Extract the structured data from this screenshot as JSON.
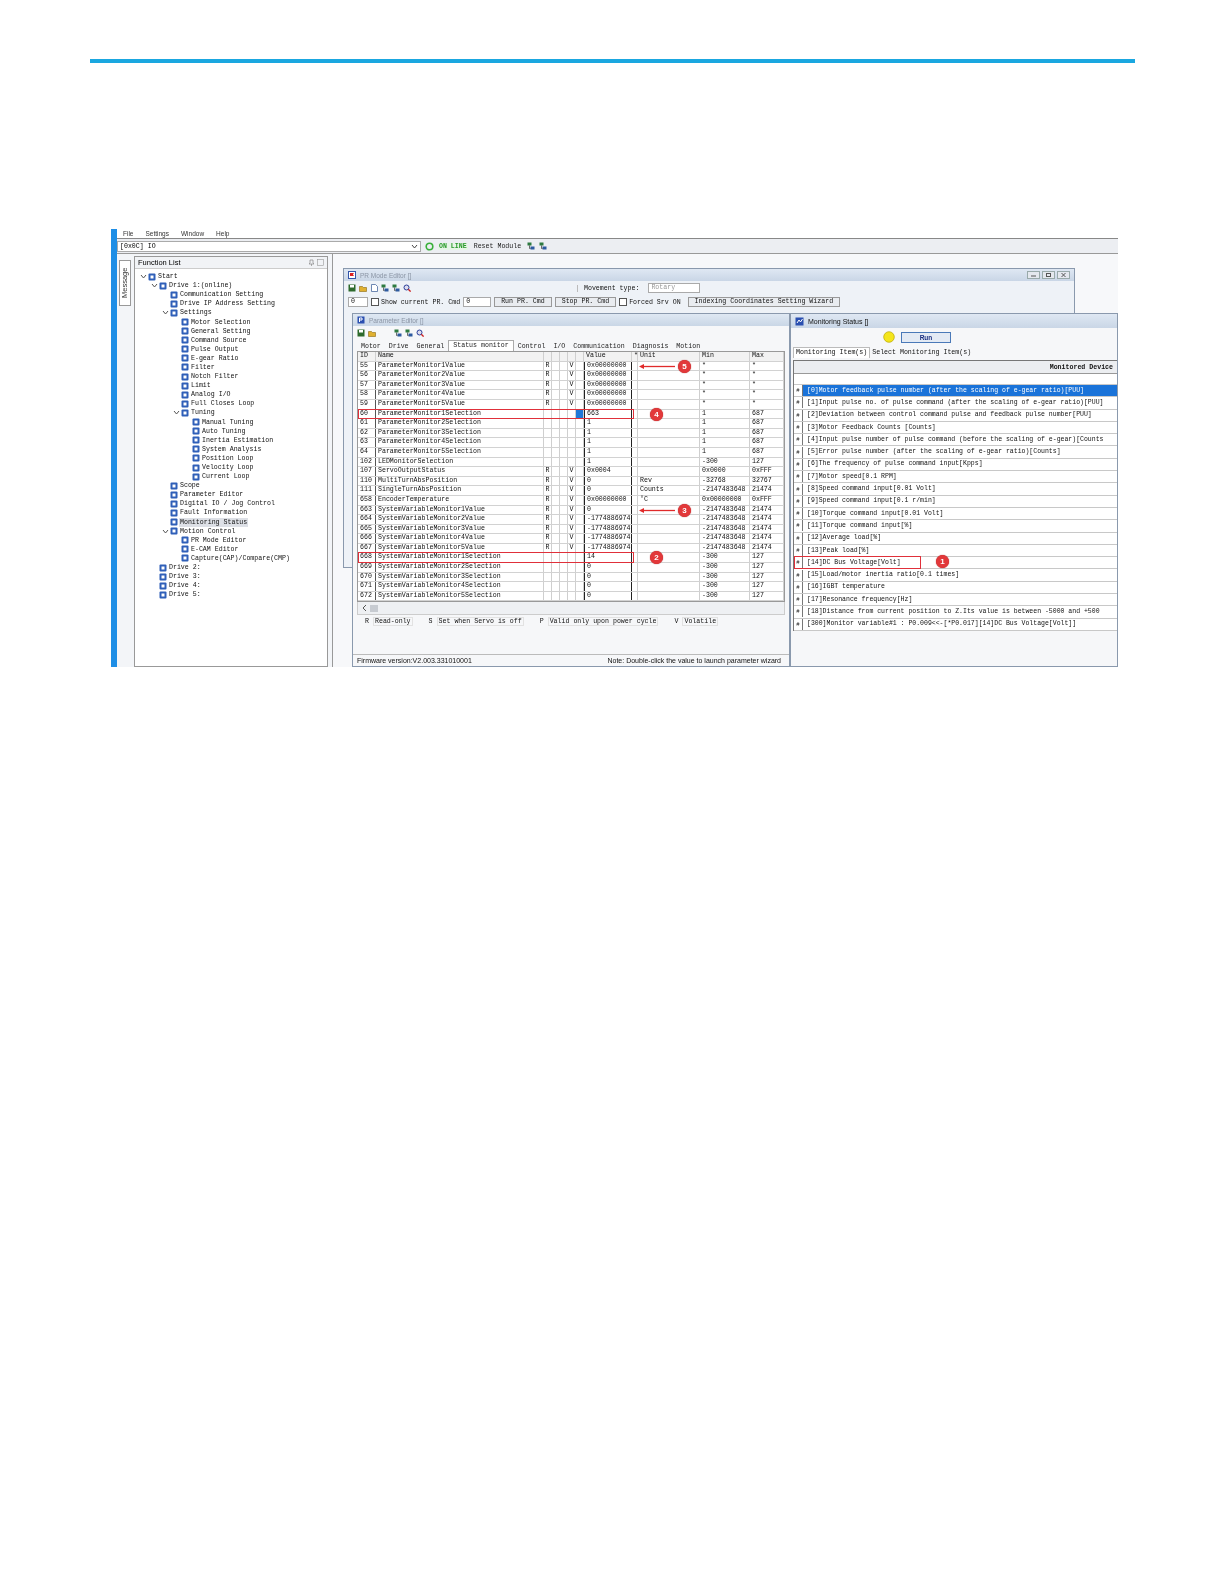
{
  "menu": [
    {
      "label": "File"
    },
    {
      "label": "Settings"
    },
    {
      "label": "Window"
    },
    {
      "label": "Help"
    }
  ],
  "toolbar": {
    "device": "[0x0C] IO",
    "status": "ON LINE",
    "reset": "Reset Module"
  },
  "side_tab": "Message",
  "function_list": {
    "title": "Function List",
    "tree": [
      {
        "label": "Start",
        "expanded": true,
        "selected": false,
        "children": [
          {
            "label": "Drive 1:(online)",
            "expanded": true,
            "selected": false,
            "children": [
              {
                "label": "Communication Setting",
                "selected": false
              },
              {
                "label": "Drive IP Address Setting",
                "selected": false
              },
              {
                "label": "Settings",
                "expanded": true,
                "selected": false,
                "children": [
                  {
                    "label": "Motor Selection",
                    "selected": false
                  },
                  {
                    "label": "General Setting",
                    "selected": false
                  },
                  {
                    "label": "Command Source",
                    "selected": false
                  },
                  {
                    "label": "Pulse Output",
                    "selected": false
                  },
                  {
                    "label": "E-gear Ratio",
                    "selected": false
                  },
                  {
                    "label": "Filter",
                    "selected": false
                  },
                  {
                    "label": "Notch Filter",
                    "selected": false
                  },
                  {
                    "label": "Limit",
                    "selected": false
                  },
                  {
                    "label": "Analog I/O",
                    "selected": false
                  },
                  {
                    "label": "Full Closes Loop",
                    "selected": false
                  },
                  {
                    "label": "Tuning",
                    "expanded": true,
                    "selected": false,
                    "children": [
                      {
                        "label": "Manual Tuning",
                        "selected": false
                      },
                      {
                        "label": "Auto Tuning",
                        "selected": false
                      },
                      {
                        "label": "Inertia Estimation",
                        "selected": false
                      },
                      {
                        "label": "System Analysis",
                        "selected": false
                      },
                      {
                        "label": "Position Loop",
                        "selected": false
                      },
                      {
                        "label": "Velocity Loop",
                        "selected": false
                      },
                      {
                        "label": "Current Loop",
                        "selected": false
                      }
                    ]
                  }
                ]
              },
              {
                "label": "Scope",
                "selected": false
              },
              {
                "label": "Parameter Editor",
                "selected": false
              },
              {
                "label": "Digital IO / Jog Control",
                "selected": false
              },
              {
                "label": "Fault Information",
                "selected": false
              },
              {
                "label": "Monitoring Status",
                "selected": true
              },
              {
                "label": "Motion Control",
                "expanded": true,
                "selected": false,
                "children": [
                  {
                    "label": "PR Mode Editor",
                    "selected": false
                  },
                  {
                    "label": "E-CAM Editor",
                    "selected": false
                  },
                  {
                    "label": "Capture(CAP)/Compare(CMP)",
                    "selected": false
                  }
                ]
              }
            ]
          },
          {
            "label": "Drive 2:",
            "selected": false
          },
          {
            "label": "Drive 3:",
            "selected": false
          },
          {
            "label": "Drive 4:",
            "selected": false
          },
          {
            "label": "Drive 5:",
            "selected": false
          }
        ]
      }
    ]
  },
  "pr_window": {
    "title": "PR Mode Editor []",
    "movement_label": "Movement type:",
    "movement_value": "Rotary",
    "pr_number": "0",
    "show_current": {
      "label": "Show current PR. Cmd",
      "checked": false
    },
    "pr_field": "0",
    "buttons": [
      "Run PR. Cmd",
      "Stop PR. Cmd"
    ],
    "forced": {
      "label": "Forced Srv ON",
      "checked": false
    },
    "wizard": "Indexing Coordinates Setting Wizard"
  },
  "parameter_editor": {
    "title": "Parameter Editor []",
    "tabs": [
      {
        "label": "Motor",
        "selected": false
      },
      {
        "label": "Drive",
        "selected": false
      },
      {
        "label": "General",
        "selected": false
      },
      {
        "label": "Status monitor",
        "selected": true
      },
      {
        "label": "Control",
        "selected": false
      },
      {
        "label": "I/O",
        "selected": false
      },
      {
        "label": "Communication",
        "selected": false
      },
      {
        "label": "Diagnosis",
        "selected": false
      },
      {
        "label": "Motion",
        "selected": false
      }
    ],
    "columns": {
      "id": "ID",
      "name": "Name",
      "value": "Value",
      "star": "*",
      "unit": "Unit",
      "min": "Min",
      "max": "Max"
    },
    "rows": [
      {
        "id": "55",
        "name": "ParameterMonitor1Value",
        "access": "R",
        "volatile": "V",
        "value": "0x00000000",
        "min": "*",
        "max": "*",
        "modified": false,
        "highlight": false,
        "callout": {
          "number": "5",
          "arrow": true
        }
      },
      {
        "id": "56",
        "name": "ParameterMonitor2Value",
        "access": "R",
        "volatile": "V",
        "value": "0x00000000",
        "min": "*",
        "max": "*",
        "modified": false,
        "highlight": false
      },
      {
        "id": "57",
        "name": "ParameterMonitor3Value",
        "access": "R",
        "volatile": "V",
        "value": "0x00000000",
        "min": "*",
        "max": "*",
        "modified": false,
        "highlight": false
      },
      {
        "id": "58",
        "name": "ParameterMonitor4Value",
        "access": "R",
        "volatile": "V",
        "value": "0x00000000",
        "min": "*",
        "max": "*",
        "modified": false,
        "highlight": false
      },
      {
        "id": "59",
        "name": "ParameterMonitor5Value",
        "access": "R",
        "volatile": "V",
        "value": "0x00000000",
        "min": "*",
        "max": "*",
        "modified": false,
        "highlight": false
      },
      {
        "id": "60",
        "name": "ParameterMonitor1Selection",
        "value": "663",
        "min": "1",
        "max": "687",
        "modified": true,
        "highlight": true,
        "callout": {
          "number": "4",
          "arrow": false
        }
      },
      {
        "id": "61",
        "name": "ParameterMonitor2Selection",
        "value": "1",
        "min": "1",
        "max": "687",
        "modified": false,
        "highlight": false
      },
      {
        "id": "62",
        "name": "ParameterMonitor3Selection",
        "value": "1",
        "min": "1",
        "max": "687",
        "modified": false,
        "highlight": false
      },
      {
        "id": "63",
        "name": "ParameterMonitor4Selection",
        "value": "1",
        "min": "1",
        "max": "687",
        "modified": false,
        "highlight": false
      },
      {
        "id": "64",
        "name": "ParameterMonitor5Selection",
        "value": "1",
        "min": "1",
        "max": "687",
        "modified": false,
        "highlight": false
      },
      {
        "id": "102",
        "name": "LEDMonitorSelection",
        "value": "1",
        "min": "-300",
        "max": "127",
        "modified": false,
        "highlight": false
      },
      {
        "id": "107",
        "name": "ServoOutputStatus",
        "access": "R",
        "volatile": "V",
        "value": "0x0004",
        "min": "0x0000",
        "max": "0xFFF",
        "modified": false,
        "highlight": false
      },
      {
        "id": "110",
        "name": "MultiTurnAbsPosition",
        "access": "R",
        "volatile": "V",
        "value": "0",
        "unit": "Rev",
        "min": "-32768",
        "max": "32767",
        "modified": false,
        "highlight": false
      },
      {
        "id": "111",
        "name": "SingleTurnAbsPosition",
        "access": "R",
        "volatile": "V",
        "value": "0",
        "unit": "Counts",
        "min": "-2147483648",
        "max": "21474",
        "modified": false,
        "highlight": false
      },
      {
        "id": "658",
        "name": "EncoderTemperature",
        "access": "R",
        "volatile": "V",
        "value": "0x00000000",
        "unit": "°C",
        "min": "0x00000000",
        "max": "0xFFF",
        "modified": false,
        "highlight": false
      },
      {
        "id": "663",
        "name": "SystemVariableMonitor1Value",
        "access": "R",
        "volatile": "V",
        "value": "0",
        "min": "-2147483648",
        "max": "21474",
        "modified": false,
        "highlight": false,
        "callout": {
          "number": "3",
          "arrow": true
        }
      },
      {
        "id": "664",
        "name": "SystemVariableMonitor2Value",
        "access": "R",
        "volatile": "V",
        "value": "-1774886974",
        "min": "-2147483648",
        "max": "21474",
        "modified": false,
        "highlight": false
      },
      {
        "id": "665",
        "name": "SystemVariableMonitor3Value",
        "access": "R",
        "volatile": "V",
        "value": "-1774886974",
        "min": "-2147483648",
        "max": "21474",
        "modified": false,
        "highlight": false
      },
      {
        "id": "666",
        "name": "SystemVariableMonitor4Value",
        "access": "R",
        "volatile": "V",
        "value": "-1774886974",
        "min": "-2147483648",
        "max": "21474",
        "modified": false,
        "highlight": false
      },
      {
        "id": "667",
        "name": "SystemVariableMonitor5Value",
        "access": "R",
        "volatile": "V",
        "value": "-1774886974",
        "min": "-2147483648",
        "max": "21474",
        "modified": false,
        "highlight": false
      },
      {
        "id": "668",
        "name": "SystemVariableMonitor1Selection",
        "value": "14",
        "min": "-300",
        "max": "127",
        "modified": false,
        "highlight": true,
        "callout": {
          "number": "2",
          "arrow": false
        }
      },
      {
        "id": "669",
        "name": "SystemVariableMonitor2Selection",
        "value": "0",
        "min": "-300",
        "max": "127",
        "modified": false,
        "highlight": false
      },
      {
        "id": "670",
        "name": "SystemVariableMonitor3Selection",
        "value": "0",
        "min": "-300",
        "max": "127",
        "modified": false,
        "highlight": false
      },
      {
        "id": "671",
        "name": "SystemVariableMonitor4Selection",
        "value": "0",
        "min": "-300",
        "max": "127",
        "modified": false,
        "highlight": false
      },
      {
        "id": "672",
        "name": "SystemVariableMonitor5Selection",
        "value": "0",
        "min": "-300",
        "max": "127",
        "modified": false,
        "highlight": false
      }
    ],
    "legend": [
      {
        "key": "R",
        "text": "Read-only"
      },
      {
        "key": "S",
        "text": "Set when Servo is off"
      },
      {
        "key": "P",
        "text": "Valid only upon power cycle"
      },
      {
        "key": "V",
        "text": "Volatile"
      }
    ],
    "firmware": "Firmware version:V2.003.331010001",
    "note": "Note: Double-click the value to launch parameter wizard"
  },
  "monitoring": {
    "title": "Monitoring Status []",
    "run": "Run",
    "tabs": [
      {
        "label": "Monitoring Item(s)",
        "selected": true
      },
      {
        "label": "Select Monitoring Item(s)",
        "selected": false
      }
    ],
    "column": "Monitored Device",
    "items": [
      {
        "mark": "#",
        "text": "[0]Motor feedback pulse number (after the scaling of e-gear ratio)[PUU]",
        "selected": true,
        "highlight": false
      },
      {
        "mark": "#",
        "text": "[1]Input pulse no. of pulse command (after the scaling of e-gear ratio)[PUU]",
        "selected": false,
        "highlight": false
      },
      {
        "mark": "#",
        "text": "[2]Deviation between control command pulse and feedback pulse number[PUU]",
        "selected": false,
        "highlight": false
      },
      {
        "mark": "#",
        "text": "[3]Motor Feedback Counts [Counts]",
        "selected": false,
        "highlight": false
      },
      {
        "mark": "#",
        "text": "[4]Input pulse number of pulse command (before the scaling of e-gear)[Counts",
        "selected": false,
        "highlight": false
      },
      {
        "mark": "#",
        "text": "[5]Error pulse number (after the scaling of e-gear ratio)[Counts]",
        "selected": false,
        "highlight": false
      },
      {
        "mark": "#",
        "text": "[6]The frequency of pulse command input[Kpps]",
        "selected": false,
        "highlight": false
      },
      {
        "mark": "#",
        "text": "[7]Motor speed[0.1 RPM]",
        "selected": false,
        "highlight": false
      },
      {
        "mark": "#",
        "text": "[8]Speed command input[0.01 Volt]",
        "selected": false,
        "highlight": false
      },
      {
        "mark": "#",
        "text": "[9]Speed command input[0.1 r/min]",
        "selected": false,
        "highlight": false
      },
      {
        "mark": "#",
        "text": "[10]Torque command input[0.01 Volt]",
        "selected": false,
        "highlight": false
      },
      {
        "mark": "#",
        "text": "[11]Torque command input[%]",
        "selected": false,
        "highlight": false
      },
      {
        "mark": "#",
        "text": "[12]Average load[%]",
        "selected": false,
        "highlight": false
      },
      {
        "mark": "#",
        "text": "[13]Peak load[%]",
        "selected": false,
        "highlight": false
      },
      {
        "mark": "#",
        "text": "[14]DC Bus Voltage[Volt]",
        "selected": false,
        "highlight": true,
        "callout": {
          "number": "1",
          "arrow": false
        }
      },
      {
        "mark": "#",
        "text": "[15]Load/motor inertia ratio[0.1 times]",
        "selected": false,
        "highlight": false
      },
      {
        "mark": "#",
        "text": "[16]IGBT temperature",
        "selected": false,
        "highlight": false
      },
      {
        "mark": "#",
        "text": "[17]Resonance frequency[Hz]",
        "selected": false,
        "highlight": false
      },
      {
        "mark": "#",
        "text": "[18]Distance from current position to Z.Its value is between -5000 and +500",
        "selected": false,
        "highlight": false
      },
      {
        "mark": "#",
        "text": "[300]Monitor variable#1 : P0.009<<-[*P0.017][14]DC Bus Voltage[Volt]]",
        "selected": false,
        "highlight": false
      }
    ]
  }
}
